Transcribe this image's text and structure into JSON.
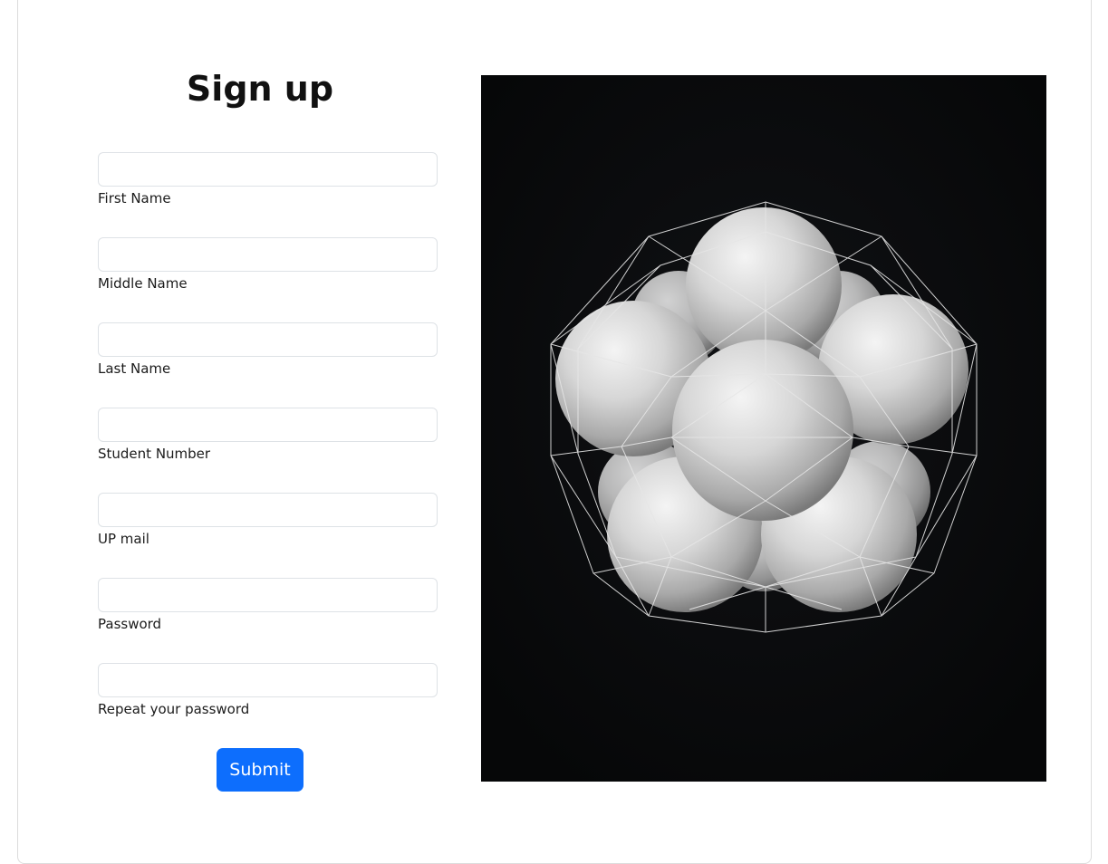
{
  "form": {
    "title": "Sign up",
    "fields": [
      {
        "label": "First Name",
        "value": "",
        "type": "text"
      },
      {
        "label": "Middle Name",
        "value": "",
        "type": "text"
      },
      {
        "label": "Last Name",
        "value": "",
        "type": "text"
      },
      {
        "label": "Student Number",
        "value": "",
        "type": "text"
      },
      {
        "label": "UP mail",
        "value": "",
        "type": "email"
      },
      {
        "label": "Password",
        "value": "",
        "type": "password"
      },
      {
        "label": "Repeat your password",
        "value": "",
        "type": "password"
      }
    ],
    "submit_label": "Submit"
  },
  "image": {
    "subject": "geometric-sphere-cluster-illustration",
    "background_color": "#08090b"
  },
  "colors": {
    "primary": "#0d6efd",
    "input_border": "#dee2e6",
    "card_border": "#dcdcdc"
  }
}
